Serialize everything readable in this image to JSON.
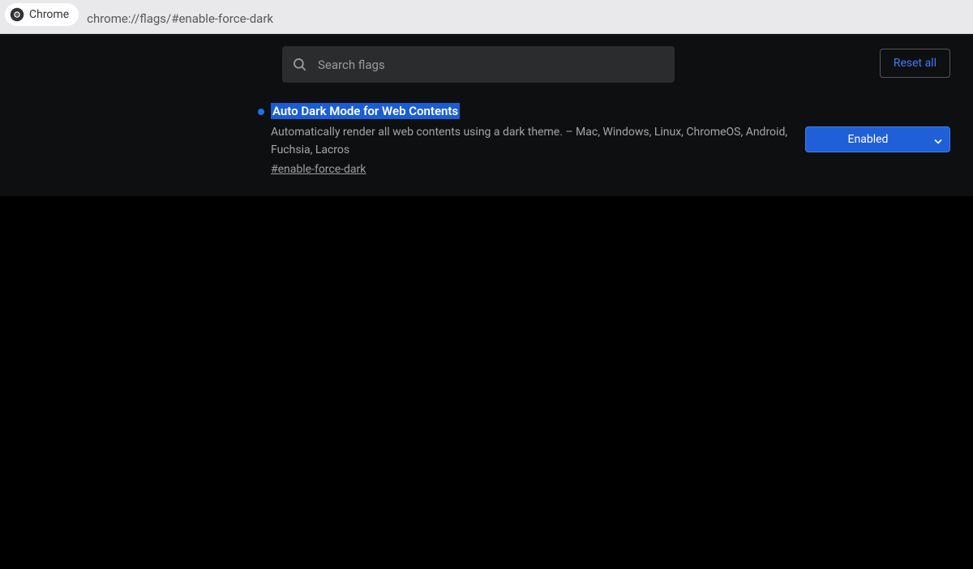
{
  "browser": {
    "app_label": "Chrome",
    "url": "chrome://flags/#enable-force-dark"
  },
  "toolbar": {
    "search_placeholder": "Search flags",
    "reset_label": "Reset all"
  },
  "flag": {
    "title": "Auto Dark Mode for Web Contents",
    "description": "Automatically render all web contents using a dark theme. – Mac, Windows, Linux, ChromeOS, Android, Fuchsia, Lacros",
    "hash": "#enable-force-dark",
    "selected": "Enabled"
  }
}
